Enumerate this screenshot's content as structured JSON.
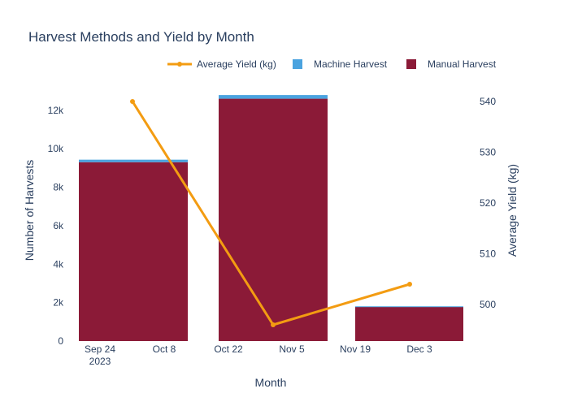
{
  "chart_data": {
    "type": "bar",
    "title": "Harvest Methods and Yield by Month",
    "xlabel": "Month",
    "ylabel": "Number of Harvests",
    "y2label": "Average Yield (kg)",
    "barmode": "stack",
    "x_ticks": [
      "Sep 24\n2023",
      "Oct 8",
      "Oct 22",
      "Nov 5",
      "Nov 19",
      "Dec 3"
    ],
    "y_ticks": [
      "0",
      "2k",
      "4k",
      "6k",
      "8k",
      "10k",
      "12k"
    ],
    "y2_ticks": [
      "500",
      "510",
      "520",
      "530",
      "540"
    ],
    "ylim": [
      0,
      13300
    ],
    "y2lim": [
      492.8,
      543.2
    ],
    "categories": [
      "2023-10",
      "2023-11",
      "2023-12"
    ],
    "series": [
      {
        "name": "Manual Harvest",
        "type": "bar",
        "axis": "y",
        "color": "#8b1a37",
        "values": [
          9300,
          12600,
          1780
        ]
      },
      {
        "name": "Machine Harvest",
        "type": "bar",
        "axis": "y",
        "color": "#4aa3df",
        "values": [
          130,
          190,
          25
        ]
      },
      {
        "name": "Average Yield (kg)",
        "type": "line",
        "axis": "y2",
        "color": "#f39c12",
        "values": [
          540,
          496,
          504
        ]
      }
    ],
    "legend": {
      "position": "top-right",
      "order": [
        "Average Yield (kg)",
        "Machine Harvest",
        "Manual Harvest"
      ]
    }
  }
}
